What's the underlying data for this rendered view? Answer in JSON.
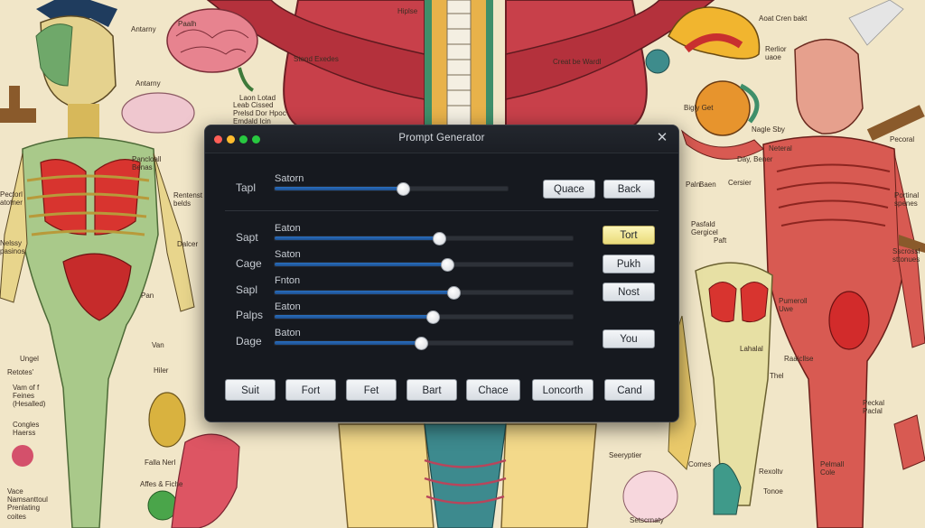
{
  "background_labels": [
    {
      "text": "Antarny"
    },
    {
      "text": "Paalh"
    },
    {
      "text": "Antarny"
    },
    {
      "text": "Stend Exedes"
    },
    {
      "text": "Hiplse"
    },
    {
      "text": "Creat be Wardl"
    },
    {
      "text": "Aoat   Cren bakt"
    },
    {
      "text": "Rerlior\nuaoe"
    },
    {
      "text": "Leab Cissed\nPrelsd Dor Hpoc\nEmdald Icin"
    },
    {
      "text": "Laon Lotad"
    },
    {
      "text": "Bigly Get"
    },
    {
      "text": "Nagle Sby"
    },
    {
      "text": "Pancloall\nBenas"
    },
    {
      "text": "Pectorl\natotner"
    },
    {
      "text": "Rentenst\nbelds"
    },
    {
      "text": "Neteral"
    },
    {
      "text": "Day, Bener"
    },
    {
      "text": "Pecoral"
    },
    {
      "text": "Paln"
    },
    {
      "text": "Portinal\nspenes"
    },
    {
      "text": "Nelssy\npasinos"
    },
    {
      "text": "Dalcer"
    },
    {
      "text": "Baen"
    },
    {
      "text": "Cersier"
    },
    {
      "text": "Pasfald\nGergicel"
    },
    {
      "text": "Paft"
    },
    {
      "text": "Sscrossl\nsttonues"
    },
    {
      "text": "Pan"
    },
    {
      "text": "Pumeroll\nUwe"
    },
    {
      "text": "Ungel"
    },
    {
      "text": "Van"
    },
    {
      "text": "Hiler"
    },
    {
      "text": "Retotes'"
    },
    {
      "text": "Vam of f\nFeines\n(Hesalled)"
    },
    {
      "text": "Lahalal"
    },
    {
      "text": "Raaicllse"
    },
    {
      "text": "Thel"
    },
    {
      "text": "Congles\nHaerss"
    },
    {
      "text": "Peckal\nPaclal"
    },
    {
      "text": "Falla Nerl"
    },
    {
      "text": "Affes & Fiche"
    },
    {
      "text": "Seeryptier"
    },
    {
      "text": "Comes"
    },
    {
      "text": "Rexoltv"
    },
    {
      "text": "Tonoe"
    },
    {
      "text": "Pelmall\nCole"
    },
    {
      "text": "Vace\nNamsanttoul\nPrenlating\ncoites"
    },
    {
      "text": "Setscrnaty"
    }
  ],
  "window": {
    "title": "Prompt Generator",
    "close_glyph": "✕",
    "rows": [
      {
        "label": "Tapl",
        "caption": "Satorn",
        "value": 0.55
      },
      {
        "label": "Sapt",
        "caption": "Eaton",
        "value": 0.55
      },
      {
        "label": "Cage",
        "caption": "Saton",
        "value": 0.58
      },
      {
        "label": "Sapl",
        "caption": "Fnton",
        "value": 0.6
      },
      {
        "label": "Palps",
        "caption": "Eaton",
        "value": 0.53
      },
      {
        "label": "Dage",
        "caption": "Baton",
        "value": 0.49
      }
    ],
    "top_buttons": [
      "Quace",
      "Back"
    ],
    "side_buttons": [
      "Tort",
      "Pukh",
      "Nost",
      "You"
    ],
    "bottom_buttons": [
      "Suit",
      "Fort",
      "Fet",
      "Bart",
      "Chace",
      "Loncorth",
      "Cand"
    ]
  },
  "colors": {
    "fill": "#2a6fbf",
    "highlight": "#fdf6b8",
    "dialog_bg": "#16191f"
  }
}
